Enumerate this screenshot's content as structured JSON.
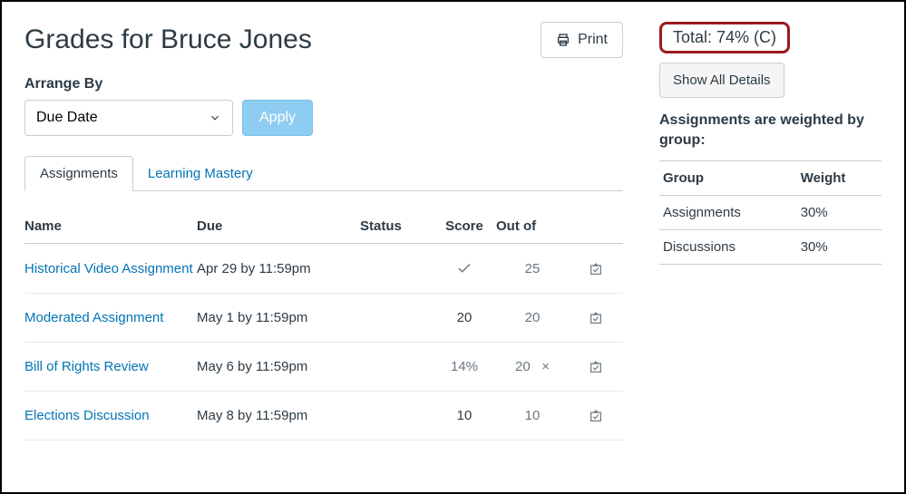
{
  "header": {
    "title": "Grades for Bruce Jones",
    "print_label": "Print"
  },
  "arrange": {
    "label": "Arrange By",
    "selected": "Due Date",
    "apply_label": "Apply"
  },
  "tabs": {
    "assignments": "Assignments",
    "learning_mastery": "Learning Mastery"
  },
  "columns": {
    "name": "Name",
    "due": "Due",
    "status": "Status",
    "score": "Score",
    "outof": "Out of"
  },
  "rows": [
    {
      "name": "Historical Video Assignment",
      "due": "Apr 29 by 11:59pm",
      "score_check": true,
      "score": "",
      "outof": "25",
      "excluded": false
    },
    {
      "name": "Moderated Assignment",
      "due": "May 1 by 11:59pm",
      "score_check": false,
      "score": "20",
      "outof": "20",
      "excluded": false
    },
    {
      "name": "Bill of Rights Review",
      "due": "May 6 by 11:59pm",
      "score_check": false,
      "score": "14%",
      "outof": "20",
      "excluded": true
    },
    {
      "name": "Elections Discussion",
      "due": "May 8 by 11:59pm",
      "score_check": false,
      "score": "10",
      "outof": "10",
      "excluded": false
    }
  ],
  "sidebar": {
    "total": "Total: 74% (C)",
    "details_label": "Show All Details",
    "weighted_label": "Assignments are weighted by group:",
    "weight_columns": {
      "group": "Group",
      "weight": "Weight"
    },
    "weights": [
      {
        "group": "Assignments",
        "weight": "30%"
      },
      {
        "group": "Discussions",
        "weight": "30%"
      }
    ]
  }
}
